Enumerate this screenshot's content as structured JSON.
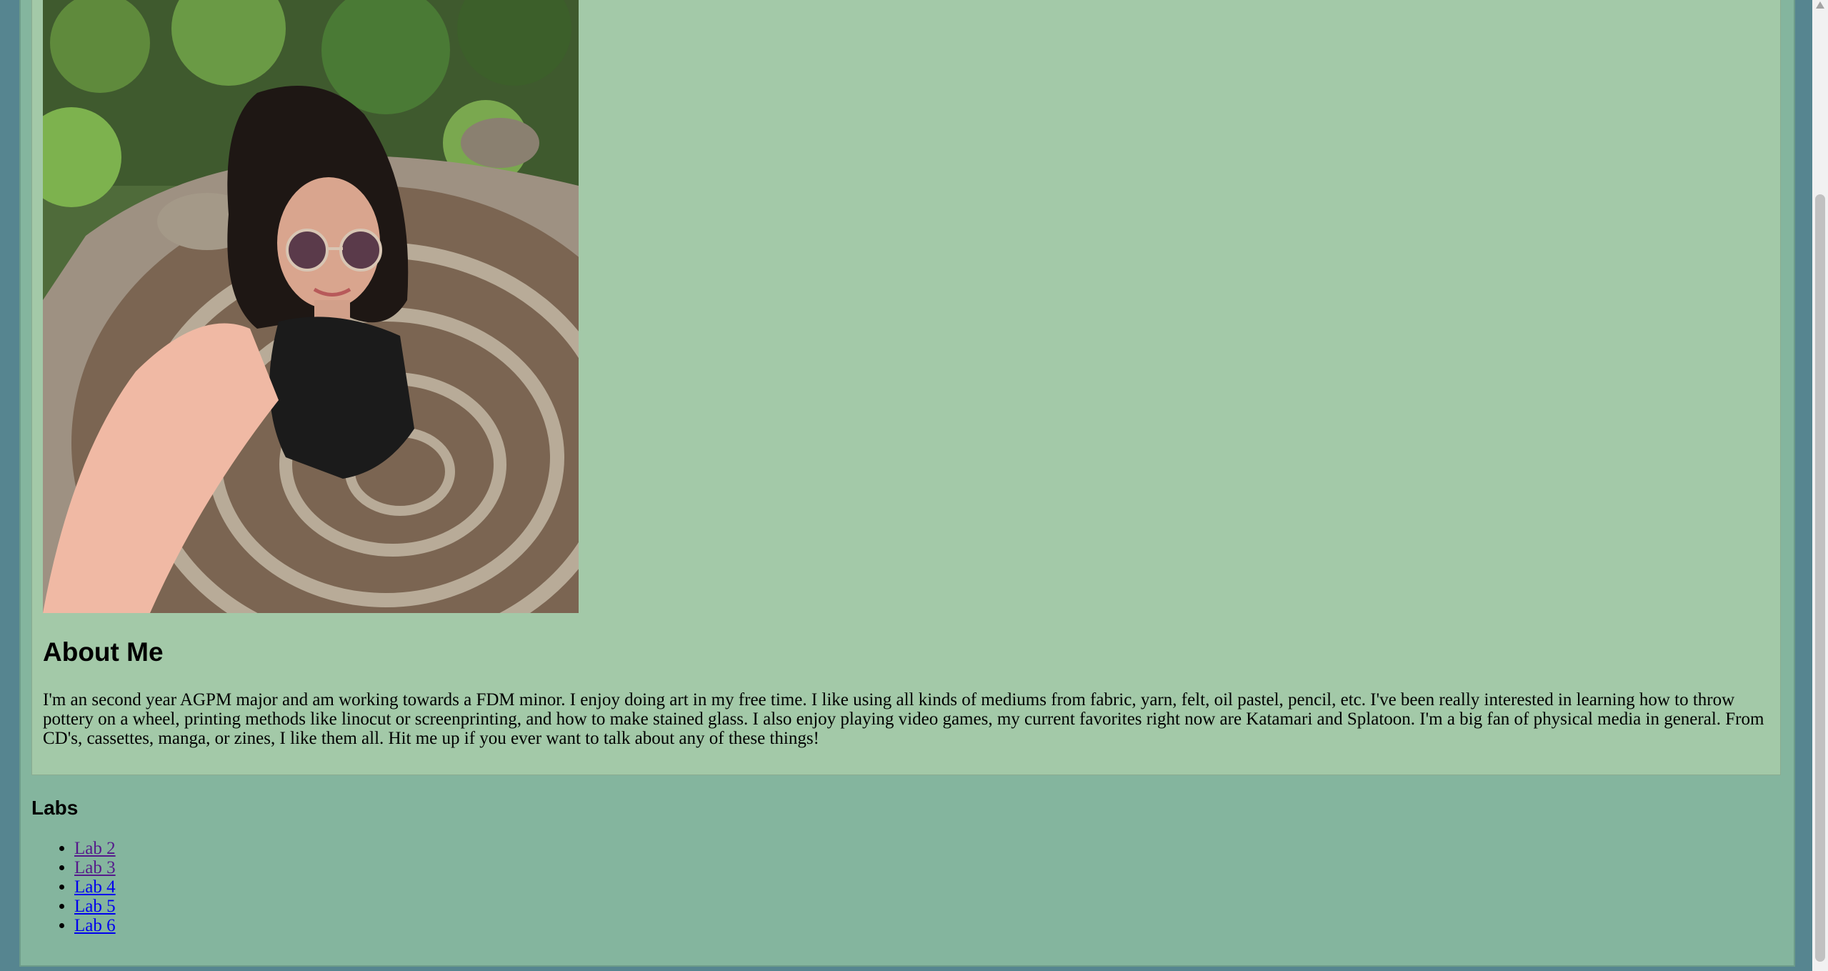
{
  "profile_photo": {
    "alt": "Selfie of a person with long dark hair and round sunglasses standing on a stone spiral"
  },
  "about": {
    "heading": "About Me",
    "text": "I'm an second year AGPM major and am working towards a FDM minor. I enjoy doing art in my free time. I like using all kinds of mediums from fabric, yarn, felt, oil pastel, pencil, etc. I've been really interested in learning how to throw pottery on a wheel, printing methods like linocut or screenprinting, and how to make stained glass. I also enjoy playing video games, my current favorites right now are Katamari and Splatoon. I'm a big fan of physical media in general. From CD's, cassettes, manga, or zines, I like them all. Hit me up if you ever want to talk about any of these things!"
  },
  "labs": {
    "heading": "Labs",
    "items": [
      {
        "label": "Lab 2",
        "visited": true
      },
      {
        "label": "Lab 3",
        "visited": true
      },
      {
        "label": "Lab 4",
        "visited": false
      },
      {
        "label": "Lab 5",
        "visited": false
      },
      {
        "label": "Lab 6",
        "visited": false
      }
    ]
  },
  "colors": {
    "page_background": "#568590",
    "wrapper_background": "#84b59e",
    "card_background": "#a3c9a8",
    "link": "#0000ee",
    "link_visited": "#551a8b"
  }
}
